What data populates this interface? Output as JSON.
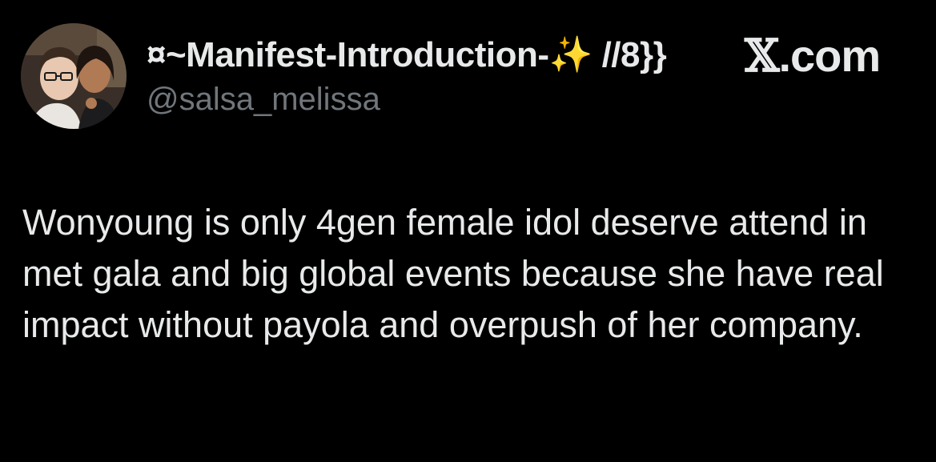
{
  "tweet": {
    "display_name_prefix": "¤~Manifest-Introduction-",
    "display_name_emoji": "✨",
    "display_name_suffix": " //8}}",
    "handle": "@salsa_melissa",
    "brand_x": "𝕏",
    "brand_domain": ".com",
    "text": "Wonyoung is only 4gen female idol deserve attend in met gala and big global events because she have real impact without payola and overpush of her company."
  },
  "colors": {
    "background": "#000000",
    "primary_text": "#e7e9ea",
    "secondary_text": "#71767b",
    "emoji": "#f5c518"
  },
  "icons": {
    "avatar": "profile-photo",
    "sparkle": "sparkles-emoji"
  }
}
